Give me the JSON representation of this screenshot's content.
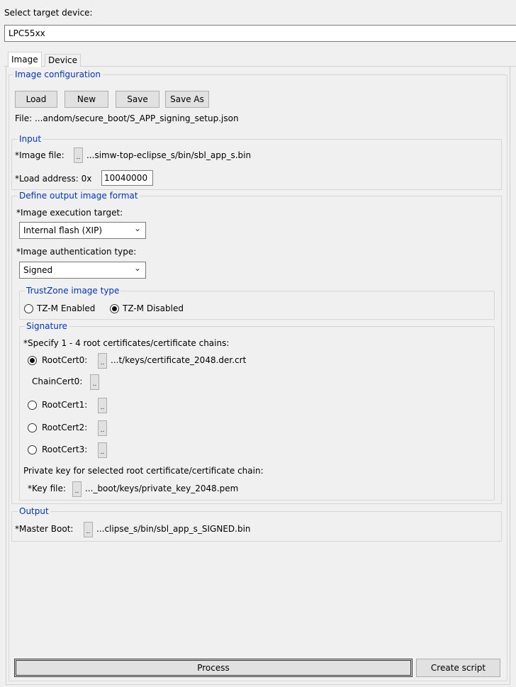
{
  "device": {
    "label": "Select target device:",
    "selected": "LPC55xx"
  },
  "tabs": [
    {
      "label": "Image",
      "active": true
    },
    {
      "label": "Device",
      "active": false
    }
  ],
  "image_config": {
    "legend": "Image configuration",
    "buttons": {
      "load": "Load",
      "new": "New",
      "save": "Save",
      "save_as": "Save As"
    },
    "file_text": "File: ...andom/secure_boot/S_APP_signing_setup.json"
  },
  "input": {
    "legend": "Input",
    "image_file_label": "*Image file:",
    "image_file_path": "...simw-top-eclipse_s/bin/sbl_app_s.bin",
    "load_address_label": "*Load address: 0x",
    "load_address_value": "10040000"
  },
  "output_format": {
    "legend": "Define output image format",
    "exec_target_label": "*Image execution target:",
    "exec_target_value": "Internal flash (XIP)",
    "auth_type_label": "*Image authentication type:",
    "auth_type_value": "Signed",
    "trustzone": {
      "legend": "TrustZone image type",
      "enabled_label": "TZ-M Enabled",
      "disabled_label": "TZ-M Disabled",
      "selected": "disabled"
    },
    "signature": {
      "legend": "Signature",
      "instruction": "*Specify 1 - 4 root certificates/certificate chains:",
      "root_cert0_label": "RootCert0:",
      "root_cert0_path": "...t/keys/certificate_2048.der.crt",
      "chain_cert0_label": "ChainCert0:",
      "root_cert1_label": "RootCert1:",
      "root_cert2_label": "RootCert2:",
      "root_cert3_label": "RootCert3:",
      "private_key_note": "Private key for selected root certificate/certificate chain:",
      "key_file_label": "*Key file:",
      "key_file_path": "..._boot/keys/private_key_2048.pem"
    }
  },
  "output": {
    "legend": "Output",
    "master_boot_label": "*Master Boot:",
    "master_boot_path": "...clipse_s/bin/sbl_app_s_SIGNED.bin"
  },
  "browse_label": "..",
  "footer": {
    "process_label": "Process",
    "create_script_label": "Create script"
  },
  "icons": {
    "dropdown": "chevron-down-icon"
  }
}
